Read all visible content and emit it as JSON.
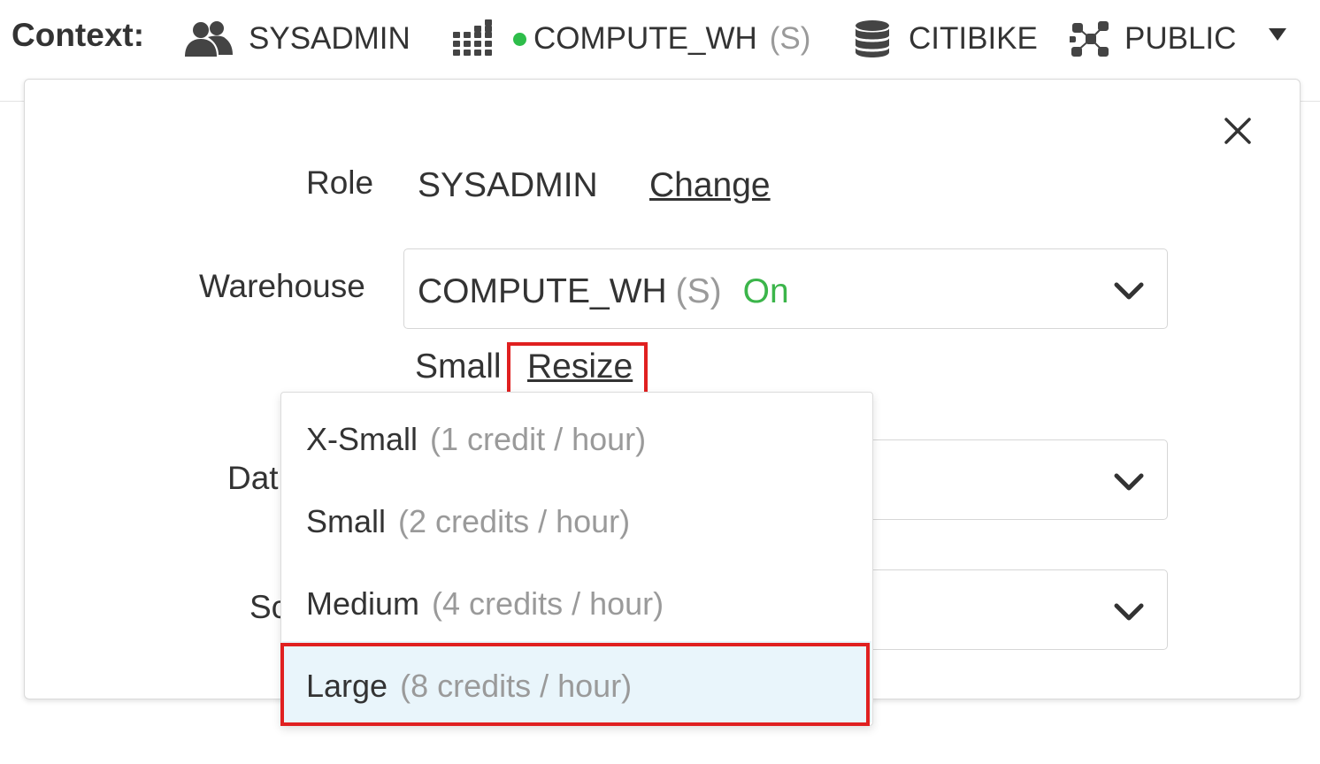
{
  "context": {
    "label": "Context:",
    "role": "SYSADMIN",
    "warehouse_name": "COMPUTE_WH",
    "warehouse_size": "(S)",
    "database": "CITIBIKE",
    "schema": "PUBLIC",
    "status_color": "#2ebd4a",
    "icons": [
      "users-icon",
      "warehouse-grid-icon",
      "database-icon",
      "schema-network-icon",
      "caret-down-icon"
    ]
  },
  "panel": {
    "role": {
      "label": "Role",
      "value": "SYSADMIN",
      "change_link": "Change"
    },
    "warehouse": {
      "label": "Warehouse",
      "name": "COMPUTE_WH",
      "size": "(S)",
      "status": "On",
      "status_color": "#3bb54a",
      "current_size": "Small",
      "resize_link": "Resize"
    },
    "database": {
      "label_visible": "Dat"
    },
    "schema": {
      "label_visible": "Sc"
    }
  },
  "size_options": [
    {
      "name": "X-Small",
      "credits": "(1 credit / hour)",
      "selected": false
    },
    {
      "name": "Small",
      "credits": "(2 credits / hour)",
      "selected": false
    },
    {
      "name": "Medium",
      "credits": "(4 credits / hour)",
      "selected": false
    },
    {
      "name": "Large",
      "credits": "(8 credits / hour)",
      "selected": true
    }
  ],
  "colors": {
    "highlight": "#e02020",
    "selected_bg": "#e9f5fb",
    "muted_text": "#9a9a9a"
  }
}
